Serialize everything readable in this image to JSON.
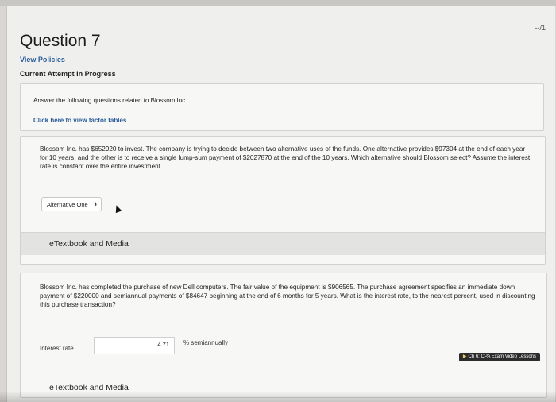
{
  "question": {
    "title": "Question 7",
    "score": "--/1",
    "view_policies": "View Policies",
    "status": "Current Attempt in Progress"
  },
  "intro": {
    "instruction": "Answer the following questions related to Blossom Inc.",
    "factor_link": "Click here to view factor tables"
  },
  "part1": {
    "text": "Blossom Inc. has $652920 to invest. The company is trying to decide between two alternative uses of the funds. One alternative provides $97304 at the end of each year for 10 years, and the other is to receive a single lump-sum payment of $2027870 at the end of the 10 years. Which alternative should Blossom select? Assume the interest rate is constant over the entire investment.",
    "select_value": "Alternative One",
    "select_arrow": "⬍",
    "media_label": "eTextbook and Media"
  },
  "part2": {
    "text": "Blossom Inc. has completed the purchase of new Dell computers. The fair value of the equipment is $906565. The purchase agreement specifies an immediate down payment of $220000 and semiannual payments of $84647 beginning at the end of 6 months for 5 years. What is the interest rate, to the nearest percent, used in discounting this purchase transaction?",
    "rate_label": "Interest rate",
    "rate_value": "4.71",
    "rate_unit": "% semiannually",
    "video_button": "Ch 6: CPA Exam Video Lessons",
    "media_label": "eTextbook and Media"
  }
}
